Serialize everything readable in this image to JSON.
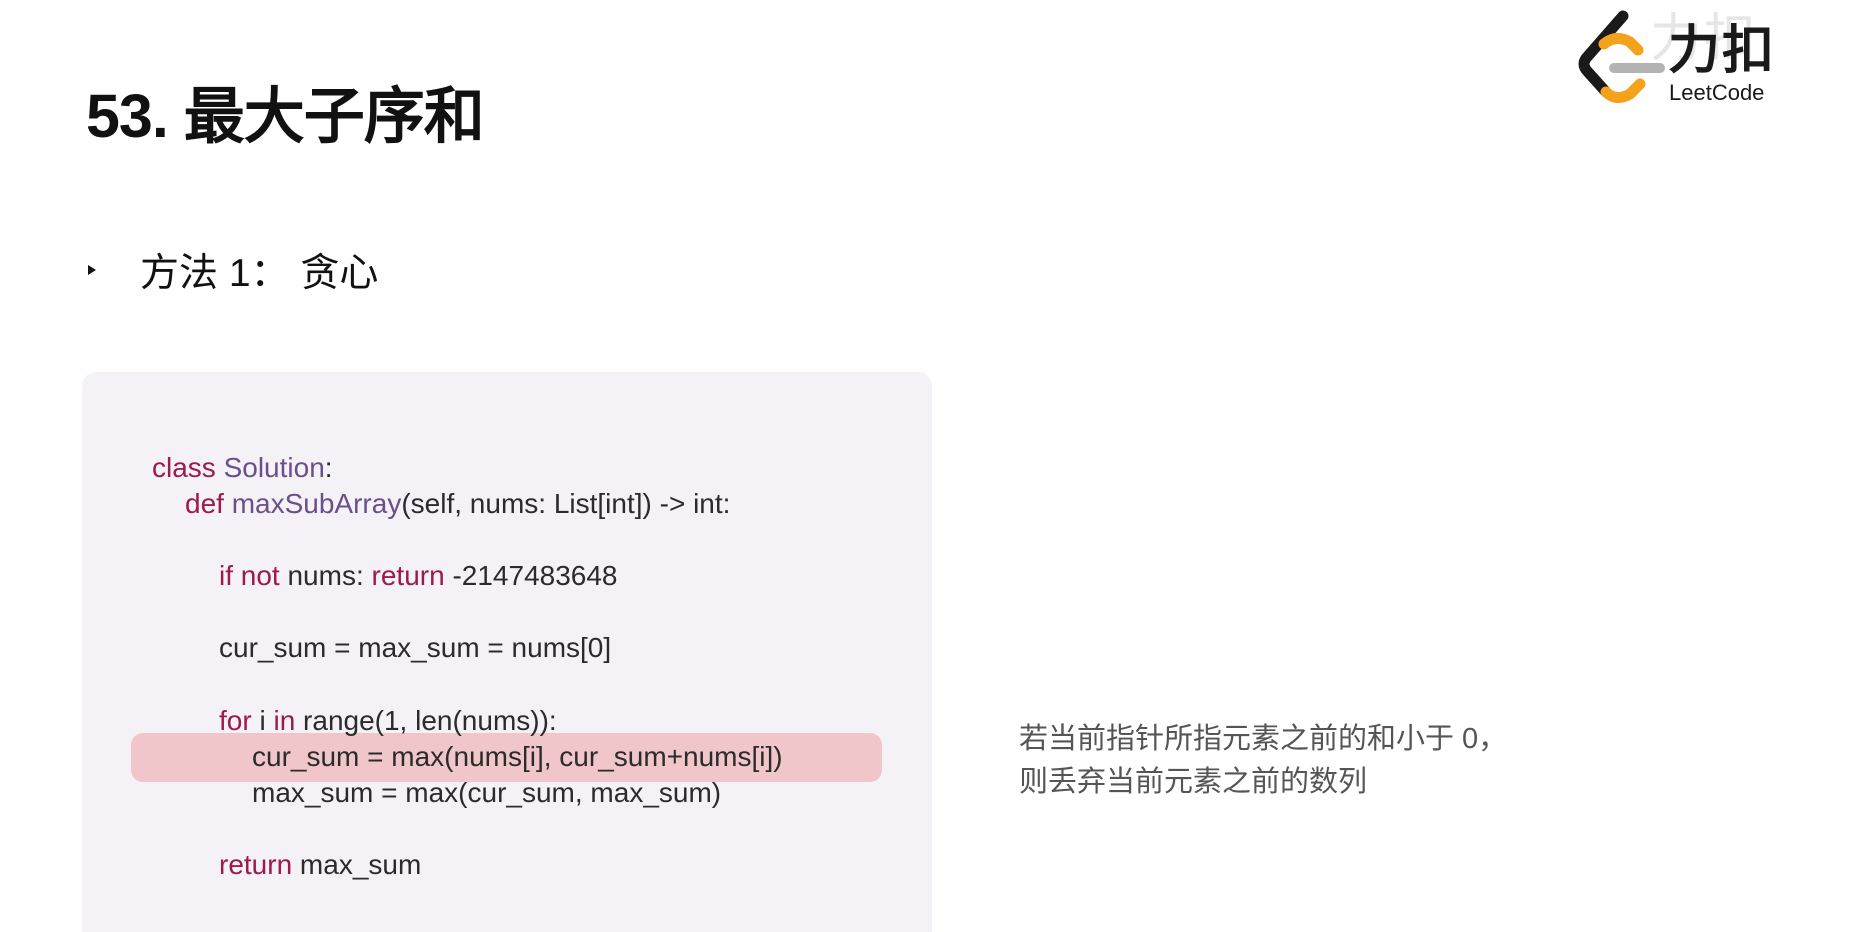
{
  "slide": {
    "title": "53. 最大子序和",
    "bullet": "方法 1： 贪心",
    "note_lines": [
      "若当前指针所指元素之前的和小于 0，",
      "则丢弃当前元素之前的数列"
    ]
  },
  "logo": {
    "cn": "力扣",
    "en": "LeetCode",
    "watermark": "力扣"
  },
  "code": {
    "line1": {
      "kw": "class",
      "cls": "Solution",
      "rest": ":"
    },
    "line2": {
      "kw": "def",
      "cls": "maxSubArray",
      "rest": "(self, nums: List[int]) -> int:"
    },
    "line3": {
      "kw1": "if not",
      "mid": " nums: ",
      "kw2": "return",
      "rest": " -2147483648"
    },
    "line4": {
      "text": "cur_sum = max_sum = nums[0]"
    },
    "line5": {
      "kw1": "for",
      "mid": " i ",
      "kw2": "in",
      "rest": " range(1, len(nums)):"
    },
    "line6": {
      "text": "cur_sum = max(nums[i], cur_sum+nums[i])"
    },
    "line7": {
      "text": "max_sum = max(cur_sum, max_sum)"
    },
    "line8": {
      "kw": "return",
      "rest": " max_sum"
    }
  },
  "colors": {
    "keyword": "#9b1b4e",
    "identifier": "#6c4f8a",
    "highlight": "#f0c6cb",
    "panel": "#f4f2f6",
    "logo_orange": "#f4a21c"
  },
  "icons": {
    "logo": "leetcode-logo-icon",
    "bullet": "triangle-bullet-icon"
  }
}
